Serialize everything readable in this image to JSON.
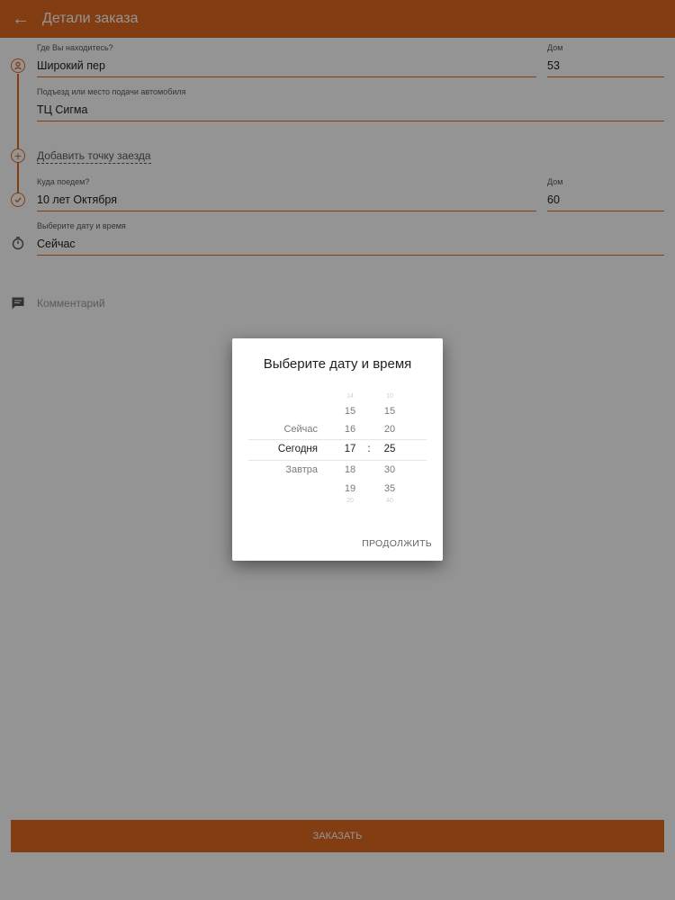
{
  "appbar": {
    "title": "Детали заказа",
    "back_icon": "arrow-left-icon"
  },
  "form": {
    "from": {
      "label": "Где Вы находитесь?",
      "value": "Широкий пер"
    },
    "from_house": {
      "label": "Дом",
      "value": "53"
    },
    "entrance": {
      "label": "Подъезд или место подачи автомобиля",
      "value": "ТЦ Сигма"
    },
    "add_stop": {
      "label": "Добавить точку заезда"
    },
    "to": {
      "label": "Куда поедем?",
      "value": "10 лет Октября"
    },
    "to_house": {
      "label": "Дом",
      "value": "60"
    },
    "datetime": {
      "label": "Выберите дату и время",
      "value": "Сейчас"
    },
    "comment": {
      "placeholder": "Комментарий"
    }
  },
  "order_button": {
    "label": "ЗАКАЗАТЬ"
  },
  "dialog": {
    "title": "Выберите дату и время",
    "days": [
      "Сейчас",
      "Сегодня",
      "Завтра"
    ],
    "hours": [
      "14",
      "15",
      "16",
      "17",
      "18",
      "19",
      "20"
    ],
    "minutes": [
      "10",
      "15",
      "20",
      "25",
      "30",
      "35",
      "40"
    ],
    "separator": ":",
    "continue_label": "ПРОДОЛЖИТЬ"
  },
  "colors": {
    "accent": "#e2691f",
    "overlay": "rgba(0,0,0,0.42)"
  }
}
